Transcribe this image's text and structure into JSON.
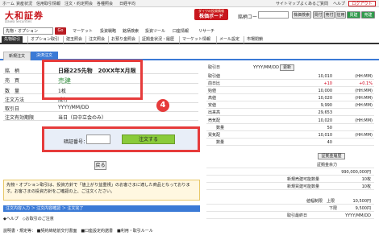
{
  "util": {
    "links": [
      "ホーム",
      "資産状況",
      "信用取引情報",
      "注文・約定照会",
      "各種照会",
      "日経平均"
    ],
    "right_links": [
      "サイトマップ",
      "よくあるご質問",
      "ヘルプ"
    ],
    "logout": "ログアウト"
  },
  "header": {
    "logo": "大和証券",
    "logo_sub": "Daiwa Securities",
    "board_top": "ダイワの投資情報",
    "board_main": "株価ボード",
    "code_label": "銘柄コード",
    "buttons": [
      "株価検索",
      "買付",
      "売付",
      "信用",
      "買建",
      "売建"
    ]
  },
  "nav": {
    "select_value": "先物・オプション",
    "go": "Go",
    "items": [
      "マーケット",
      "投資戦略",
      "銘柄検索",
      "投資ツール",
      "口座情報",
      "リサーチ"
    ]
  },
  "subnav": {
    "items": [
      "先物取引",
      "オプション取引",
      "建玉照会",
      "注文照会",
      "お預り金照会",
      "証拠金状況・履歴",
      "マーケット情報",
      "メール設定",
      "市場閉鎖"
    ]
  },
  "subtabs": {
    "items": [
      "新規注文",
      "決済注文"
    ]
  },
  "form": {
    "rows": [
      {
        "label": "銘　柄",
        "value": "日経225先物　20XX年X月限"
      },
      {
        "label": "売　買",
        "value": "売建"
      },
      {
        "label": "数　量",
        "value": "1枚"
      },
      {
        "label": "注文方法",
        "value": "成行"
      },
      {
        "label": "取引日",
        "value": "YYYY/MM/DD"
      },
      {
        "label": "注文有効期限",
        "value": "当日（日中立会のみ）"
      }
    ],
    "pw_label": "暗証番号：",
    "order_button": "注文する",
    "back_button": "戻る",
    "badge": "4",
    "colors": {
      "sell": "#2e8b3a",
      "highlight": "#e63b3b",
      "accent": "#3b7ad6"
    }
  },
  "notice": "先物・オプション取引は、投資方針で「値上がり益重視」のお客さまに適した商品となっております。お客さまの投資方針をご確認の上、ご注文ください。",
  "steps": "注文内容入力 ＞ 注文内容確認 ＞ 注文完了",
  "links": "◆ヘルプ　◇お取引のご注意",
  "links2": "説明書・規定等： ■契約締結前交付書面　■口座設定約諾書　■利用・取引ルール",
  "right": {
    "date_label": "取引日",
    "date_value": "YYYY/MM/DD",
    "refresh": "更新",
    "rows": [
      {
        "l": "取引値",
        "v": "10,010",
        "t": "(HH:MM)"
      },
      {
        "l": "前日比",
        "v": "+10",
        "t": "+0.1%"
      },
      {
        "l": "始値",
        "v": "10,000",
        "t": "(HH:MM)"
      },
      {
        "l": "高値",
        "v": "10,020",
        "t": "(HH:MM)"
      },
      {
        "l": "安値",
        "v": "9,990",
        "t": "(HH:MM)"
      },
      {
        "l": "出来高",
        "v": "29,653",
        "t": ""
      },
      {
        "l": "売気配",
        "v": "10,020",
        "t": "(HH:MM)"
      },
      {
        "l": "数量",
        "v": "50",
        "t": ""
      },
      {
        "l": "買気配",
        "v": "10,010",
        "t": "(HH:MM)"
      },
      {
        "l": "数量",
        "v": "40",
        "t": ""
      }
    ],
    "margin_btn": "証拠金履歴",
    "margin_label": "証拠金余力",
    "margin_value": "990,000,000円",
    "rows2": [
      {
        "l": "新規売建可能数量",
        "v": "10枚"
      },
      {
        "l": "新規買建可能数量",
        "v": "10枚"
      }
    ],
    "limits": [
      {
        "l": "値幅制限　上限",
        "v": "10,500円"
      },
      {
        "l": "下限",
        "v": "9,500円"
      },
      {
        "l": "取引最終日",
        "v": "YYYY/MM/DD"
      }
    ]
  }
}
